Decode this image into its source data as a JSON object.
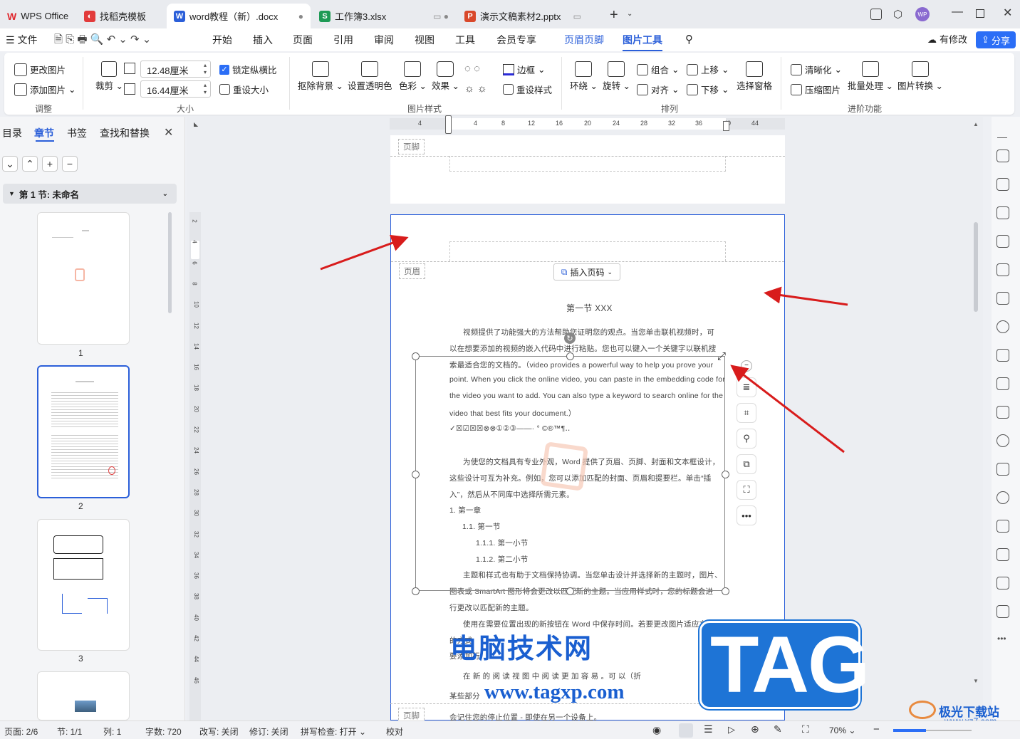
{
  "tabs": {
    "home": "WPS Office",
    "tab1": "找稻壳模板",
    "tab2": "word教程（新）.docx",
    "tab3": "工作簿3.xlsx",
    "tab4": "演示文稿素材2.pptx"
  },
  "menu": {
    "file": "文件",
    "items": [
      "开始",
      "插入",
      "页面",
      "引用",
      "审阅",
      "视图",
      "工具",
      "会员专享",
      "页眉页脚",
      "图片工具"
    ],
    "status": "有修改",
    "share": "分享"
  },
  "ribbon": {
    "change_image": "更改图片",
    "add_image": "添加图片",
    "crop": "裁剪",
    "width": "12.48厘米",
    "height": "16.44厘米",
    "lock_ratio": "锁定纵横比",
    "reset_size": "重设大小",
    "remove_bg": "抠除背景",
    "set_transparent": "设置透明色",
    "color": "色彩",
    "effect": "效果",
    "border": "边框",
    "reset_style": "重设样式",
    "wrap": "环绕",
    "rotate": "旋转",
    "group": "组合",
    "align": "对齐",
    "move_up": "上移",
    "move_down": "下移",
    "selection_pane": "选择窗格",
    "sharpen": "清晰化",
    "compress": "压缩图片",
    "batch": "批量处理",
    "convert": "图片转换",
    "group_adjust": "调整",
    "group_size": "大小",
    "group_style": "图片样式",
    "group_arrange": "排列",
    "group_advanced": "进阶功能"
  },
  "leftpane": {
    "tabs": [
      "目录",
      "章节",
      "书签",
      "查找和替换"
    ],
    "section": "第 1 节: 未命名",
    "pages": [
      "1",
      "2",
      "3"
    ]
  },
  "ruler": {
    "h": [
      "4",
      "4",
      "8",
      "12",
      "16",
      "20",
      "24",
      "28",
      "32",
      "36",
      "40",
      "44"
    ],
    "v": [
      "2",
      "4",
      "6",
      "8",
      "10",
      "12",
      "14",
      "16",
      "18",
      "20",
      "22",
      "24",
      "26",
      "28",
      "30",
      "32",
      "34",
      "36",
      "38",
      "40",
      "42",
      "44",
      "46"
    ]
  },
  "doc": {
    "footer_label": "页脚",
    "header_label": "页眉",
    "insert_page_num": "插入页码",
    "heading": "第一节  XXX",
    "lines": [
      "视频提供了功能强大的方法帮助您证明您的观点。当您单击联机视频时，可",
      "以在想要添加的视频的嵌入代码中进行粘贴。您也可以键入一个关键字以联机搜",
      "索最适合您的文档的。（video provides a powerful way to help you prove your",
      "point. When you click the online video, you can paste in the embedding code for",
      "the video you want to add. You can also type a keyword to search online for the",
      "video that best fits your document.）",
      "✓☒☑☒☒⊗⊗①②③——·  °  ©®™¶‥",
      "为使您的文档具有专业外观，Word 提供了页眉、页脚、封面和文本框设计，",
      "这些设计可互为补充。例如，您可以添加匹配的封面、页眉和提要栏。单击“插",
      "入”，然后从不同库中选择所需元素。",
      "1.   第一章",
      "1.1.  第一节",
      "1.1.1.   第一小节",
      "1.1.2.   第二小节",
      "主题和样式也有助于文档保持协调。当您单击设计并选择新的主题时，图片、",
      "图表或 SmartArt 图形将会更改以匹配新的主题。当应用样式时，您的标题会进",
      "行更改以匹配新的主题。",
      "使用在需要位置出现的新按钮在 Word 中保存时间。若要更改图片适应文档",
      "的方式",
      "要添加行",
      "在 新 的 阅 读 视 图 中 阅 读 更 加 容 易 。可 以（折",
      "某些部分",
      "会记住您的停止位置 - 即使在另一个设备上。"
    ]
  },
  "watermark": {
    "title": "电脑技术网",
    "url": "www.tagxp.com",
    "tag": "TAG",
    "site2": "极光下载站",
    "site2_url": "www.xz7.com"
  },
  "status": {
    "page": "页面: 2/6",
    "section": "节: 1/1",
    "col": "列: 1",
    "words": "字数: 720",
    "rewrite": "改写: 关闭",
    "revise": "修订: 关闭",
    "spell": "拼写检查: 打开",
    "proof": "校对",
    "zoom": "70%"
  }
}
